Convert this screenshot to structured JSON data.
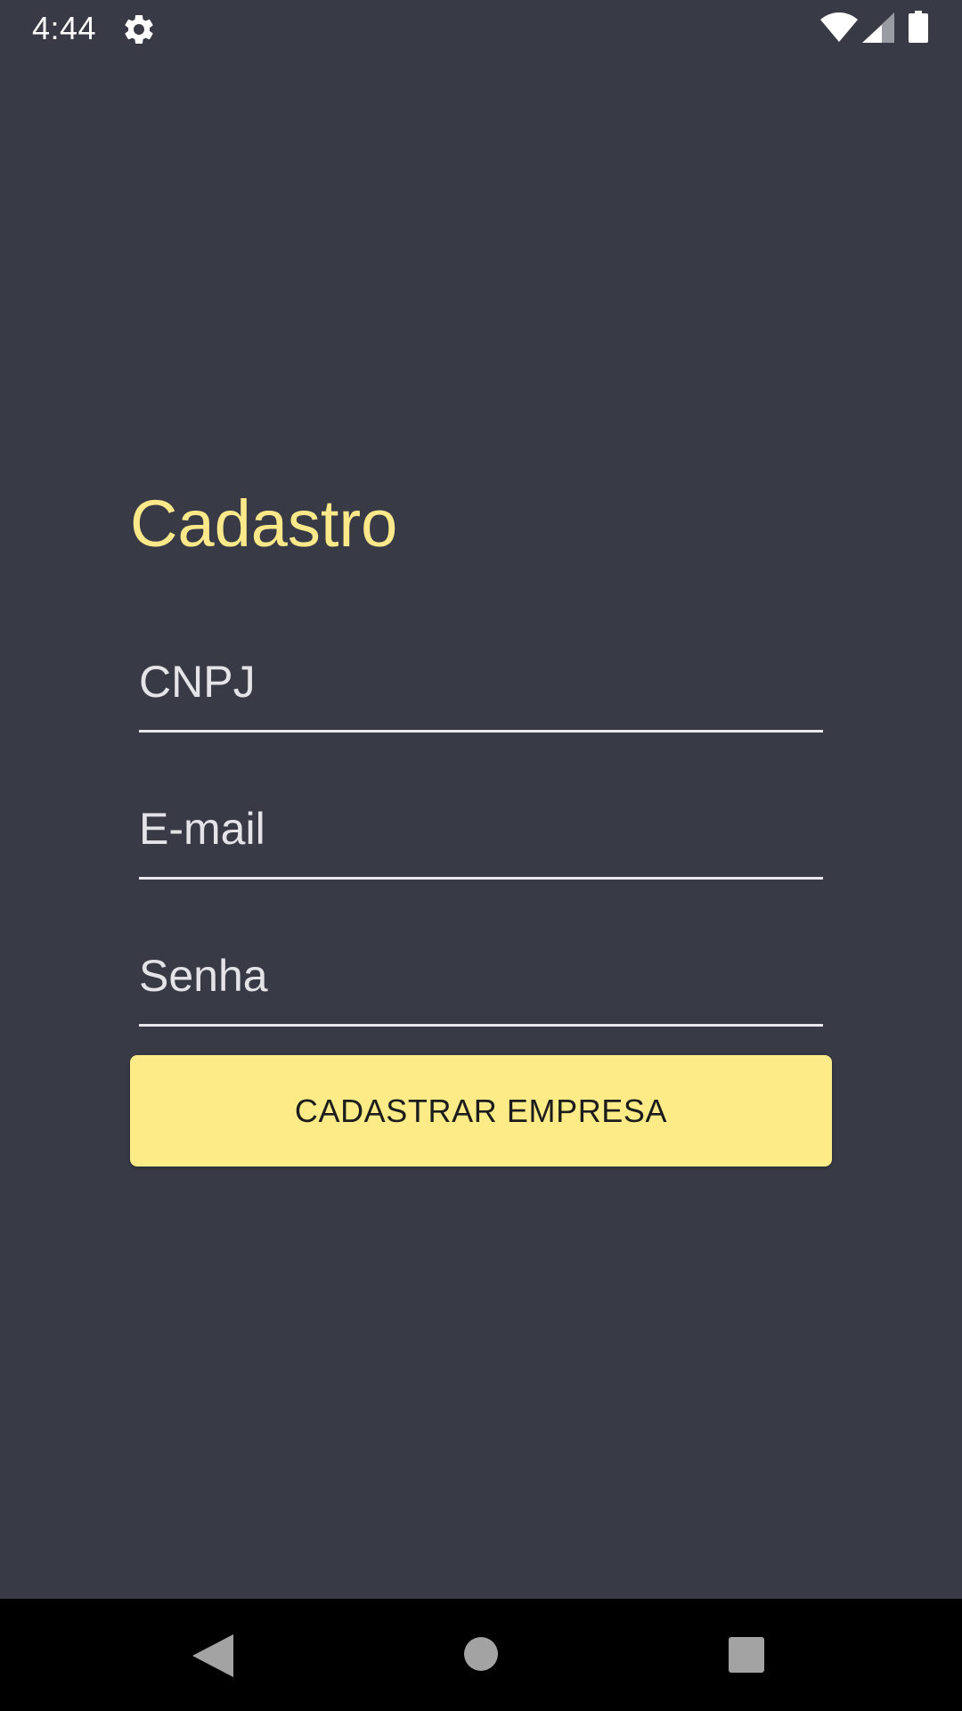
{
  "status_bar": {
    "time": "4:44",
    "icons": [
      "settings-icon",
      "wifi-icon",
      "cell-signal-icon",
      "battery-icon"
    ]
  },
  "form": {
    "title": "Cadastro",
    "fields": [
      {
        "name": "cnpj",
        "placeholder": "CNPJ",
        "value": ""
      },
      {
        "name": "email",
        "placeholder": "E-mail",
        "value": ""
      },
      {
        "name": "senha",
        "placeholder": "Senha",
        "value": ""
      }
    ],
    "submit_label": "CADASTRAR EMPRESA"
  },
  "nav_bar": {
    "buttons": [
      "back-icon",
      "home-icon",
      "recents-icon"
    ]
  },
  "colors": {
    "background": "#383b46",
    "accent": "#fde98a",
    "button_background": "#fdeb88",
    "button_text": "#1c1c1c",
    "field_text": "#e3e3e8",
    "nav_background": "#000000"
  }
}
